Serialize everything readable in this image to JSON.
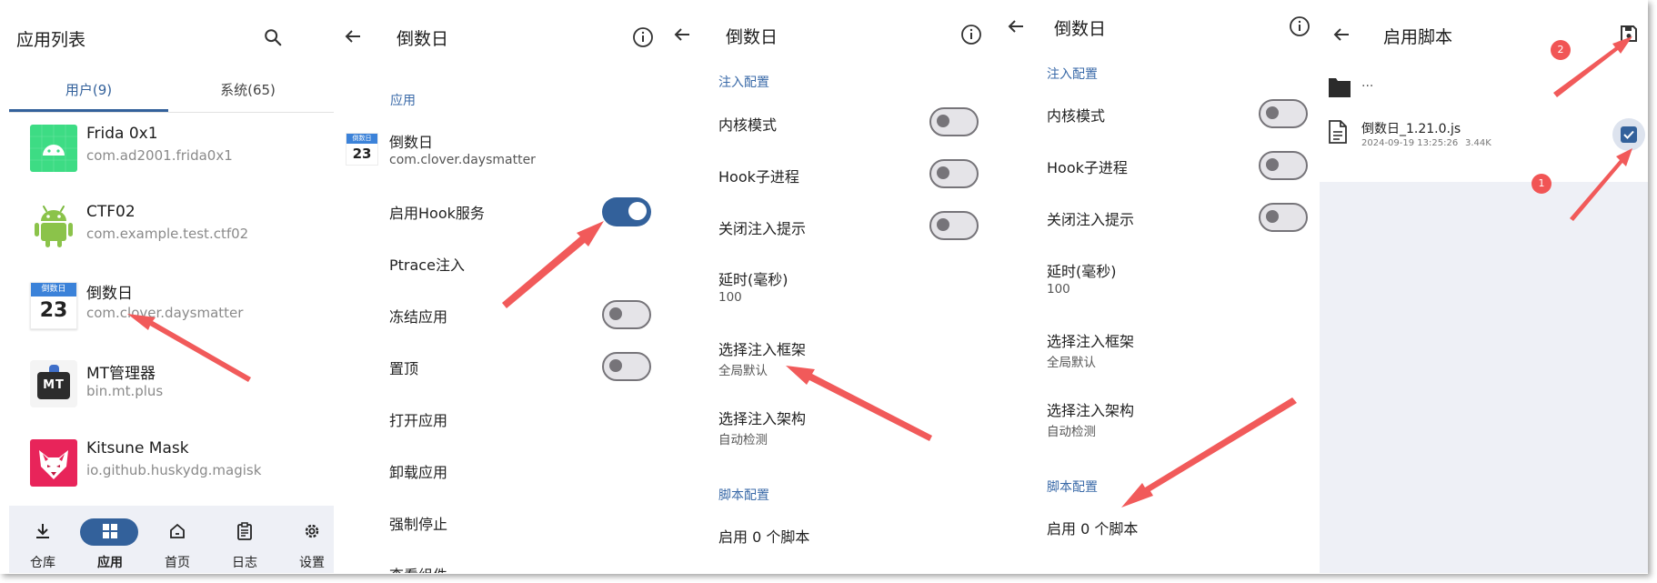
{
  "panel1": {
    "title": "应用列表",
    "tabs": [
      {
        "label": "用户(9)"
      },
      {
        "label": "系统(65)"
      }
    ],
    "apps": [
      {
        "name": "Frida 0x1",
        "pkg": "com.ad2001.frida0x1"
      },
      {
        "name": "CTF02",
        "pkg": "com.example.test.ctf02"
      },
      {
        "name": "倒数日",
        "pkg": "com.clover.daysmatter",
        "icon_top": "倒数日",
        "icon_num": "23"
      },
      {
        "name": "MT管理器",
        "pkg": "bin.mt.plus",
        "icon_text": "MT"
      },
      {
        "name": "Kitsune Mask",
        "pkg": "io.github.huskydg.magisk"
      }
    ],
    "nav": [
      {
        "label": "仓库"
      },
      {
        "label": "应用"
      },
      {
        "label": "首页"
      },
      {
        "label": "日志"
      },
      {
        "label": "设置"
      }
    ]
  },
  "panel2": {
    "title": "倒数日",
    "section": "应用",
    "app": {
      "name": "倒数日",
      "pkg": "com.clover.daysmatter",
      "icon_top": "倒数日",
      "icon_num": "23"
    },
    "items": [
      {
        "label": "启用Hook服务",
        "toggle": "on"
      },
      {
        "label": "Ptrace注入"
      },
      {
        "label": "冻结应用",
        "toggle": "off"
      },
      {
        "label": "置顶",
        "toggle": "off"
      },
      {
        "label": "打开应用"
      },
      {
        "label": "卸载应用"
      },
      {
        "label": "强制停止"
      },
      {
        "label": "查看组件"
      }
    ]
  },
  "panel3": {
    "title": "倒数日",
    "section_inject": "注入配置",
    "items": [
      {
        "label": "内核模式",
        "toggle": "off"
      },
      {
        "label": "Hook子进程",
        "toggle": "off"
      },
      {
        "label": "关闭注入提示",
        "toggle": "off"
      }
    ],
    "delay": {
      "label": "延时(毫秒)",
      "value": "100"
    },
    "framework": {
      "label": "选择注入框架",
      "value": "全局默认"
    },
    "arch": {
      "label": "选择注入架构",
      "value": "自动检测"
    },
    "section_script": "脚本配置",
    "scripts": "启用 0 个脚本"
  },
  "panel4": {
    "title": "倒数日",
    "section_inject": "注入配置",
    "items": [
      {
        "label": "内核模式",
        "toggle": "off"
      },
      {
        "label": "Hook子进程",
        "toggle": "off"
      },
      {
        "label": "关闭注入提示",
        "toggle": "off"
      }
    ],
    "delay": {
      "label": "延时(毫秒)",
      "value": "100"
    },
    "framework": {
      "label": "选择注入框架",
      "value": "全局默认"
    },
    "arch": {
      "label": "选择注入架构",
      "value": "自动检测"
    },
    "section_script": "脚本配置",
    "scripts": "启用 0 个脚本"
  },
  "panel5": {
    "title": "启用脚本",
    "parent": "...",
    "file": {
      "name": "倒数日_1.21.0.js",
      "date": "2024-09-19 13:25:26",
      "size": "3.44K",
      "checked": true
    },
    "badges": [
      "1",
      "2"
    ]
  },
  "colors": {
    "accent": "#33619b",
    "section": "#3a6aa8",
    "arrow": "#f15a5a",
    "nav_bg": "#eef0f6"
  }
}
